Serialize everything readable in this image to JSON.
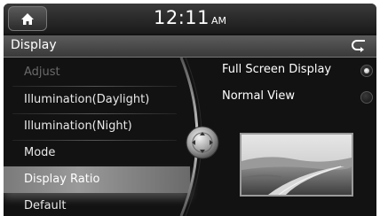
{
  "status_bar": {
    "time": "12:11",
    "ampm": "AM"
  },
  "title_bar": {
    "title": "Display"
  },
  "menu": {
    "items": [
      {
        "label": "Adjust",
        "state": "disabled"
      },
      {
        "label": "Illumination(Daylight)",
        "state": "normal"
      },
      {
        "label": "Illumination(Night)",
        "state": "normal"
      },
      {
        "label": "Mode",
        "state": "normal"
      },
      {
        "label": "Display Ratio",
        "state": "selected"
      },
      {
        "label": "Default",
        "state": "normal"
      }
    ]
  },
  "options": [
    {
      "label": "Full Screen Display",
      "selected": true
    },
    {
      "label": "Normal View",
      "selected": false
    }
  ],
  "icons": {
    "home": "home-icon",
    "back": "back-arrow-icon",
    "jog": "jog-dial-icon"
  },
  "colors": {
    "background": "#121212",
    "selected_item": "#8a8a8a",
    "text": "#ffffff",
    "disabled_text": "#6a6a6a"
  }
}
